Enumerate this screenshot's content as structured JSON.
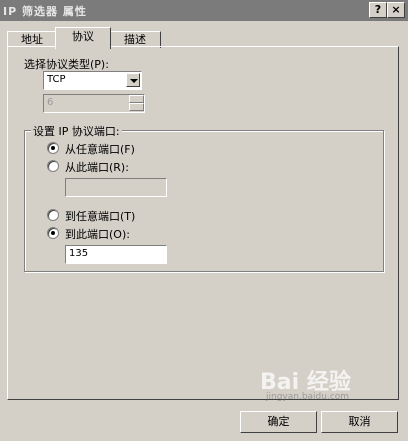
{
  "window": {
    "title": "IP 筛选器 属性",
    "help_glyph": "?",
    "close_glyph": "×"
  },
  "tabs": [
    {
      "label": "地址"
    },
    {
      "label": "协议"
    },
    {
      "label": "描述"
    }
  ],
  "protocol_type": {
    "label": "选择协议类型(P):",
    "value": "TCP",
    "spinner_value": "6"
  },
  "ports_group": {
    "title": "设置 IP 协议端口:",
    "from_any": "从任意端口(F)",
    "from_port": "从此端口(R):",
    "from_port_value": "",
    "to_any": "到任意端口(T)",
    "to_port": "到此端口(O):",
    "to_port_value": "135"
  },
  "buttons": {
    "ok": "确定",
    "cancel": "取消"
  },
  "watermark": {
    "text": "Bai 经验",
    "url": "jingyan.baidu.com"
  }
}
